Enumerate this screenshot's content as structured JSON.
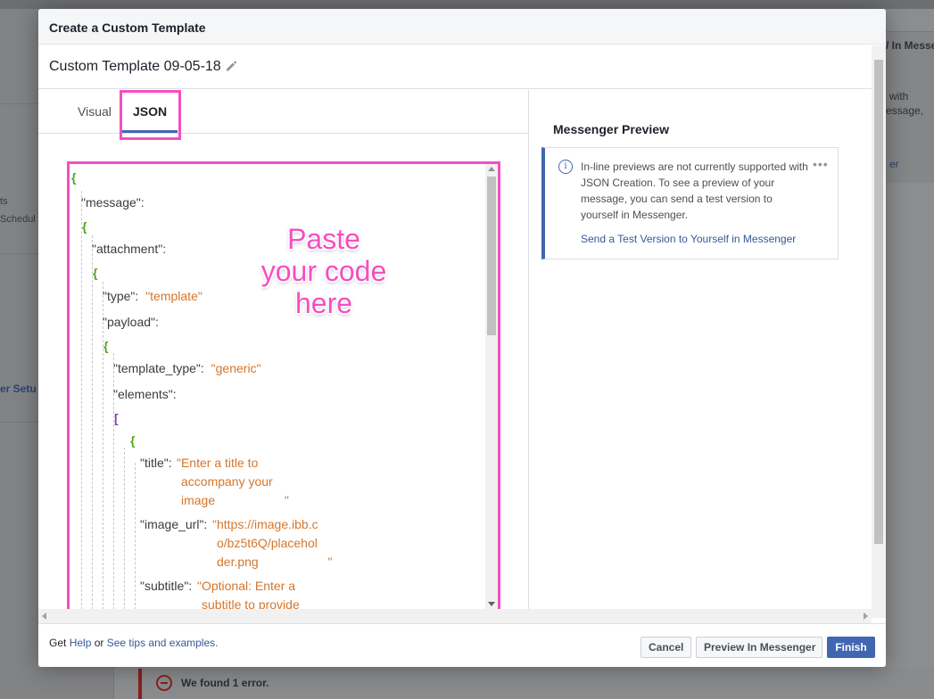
{
  "background": {
    "left_text_1": "ts",
    "left_text_2": "Schedul",
    "left_link": "er Setu",
    "right_header": "/ In Messe",
    "right_text_1": "with",
    "right_text_2": "essage,",
    "right_link": "er",
    "error_text": "We found 1 error."
  },
  "modal": {
    "title": "Create a Custom Template",
    "template_name": "Custom Template 09-05-18",
    "tabs": [
      {
        "label": "Visual",
        "active": false
      },
      {
        "label": "JSON",
        "active": true
      }
    ],
    "annotation": "Paste your code here",
    "editor": {
      "lines": {
        "l1": "{",
        "l2": "\"message\":",
        "l3": "{",
        "l4": "\"attachment\":",
        "l5": "{",
        "l6_key": "\"type\":",
        "l6_val": "\"template\"",
        "l7": "\"payload\":",
        "l8": "{",
        "l9_key": "\"template_type\":",
        "l9_val": "\"generic\"",
        "l10": "\"elements\":",
        "l11": "[",
        "l12": "{",
        "l13_key": "\"title\":",
        "l13_val_a": "\"Enter a title to",
        "l13_val_b": "accompany your",
        "l13_val_c": "image                    \"",
        "l14_key": "\"image_url\":",
        "l14_val_a": "\"https://image.ibb.c",
        "l14_val_b": "o/bz5t6Q/placehol",
        "l14_val_c": "der.png                    \"",
        "l15_key": "\"subtitle\":",
        "l15_val_a": "\"Optional: Enter a",
        "l15_val_b": "subtitle to provide"
      }
    },
    "preview": {
      "title": "Messenger Preview",
      "info_glyph": "i",
      "notice": "In-line previews are not currently supported with JSON Creation. To see a preview of your message, you can send a test version to yourself in Messenger.",
      "link": "Send a Test Version to Yourself in Messenger",
      "more": "•••"
    },
    "footer": {
      "get": "Get",
      "help": "Help",
      "or": "or",
      "tips": "See tips and examples.",
      "cancel": "Cancel",
      "preview": "Preview In Messenger",
      "finish": "Finish"
    }
  },
  "colors": {
    "accent": "#4267b2",
    "highlight": "#f54ec2",
    "json_string": "#d5762b",
    "json_brace": "#4ea51a",
    "json_bracket": "#8b3ea8"
  }
}
